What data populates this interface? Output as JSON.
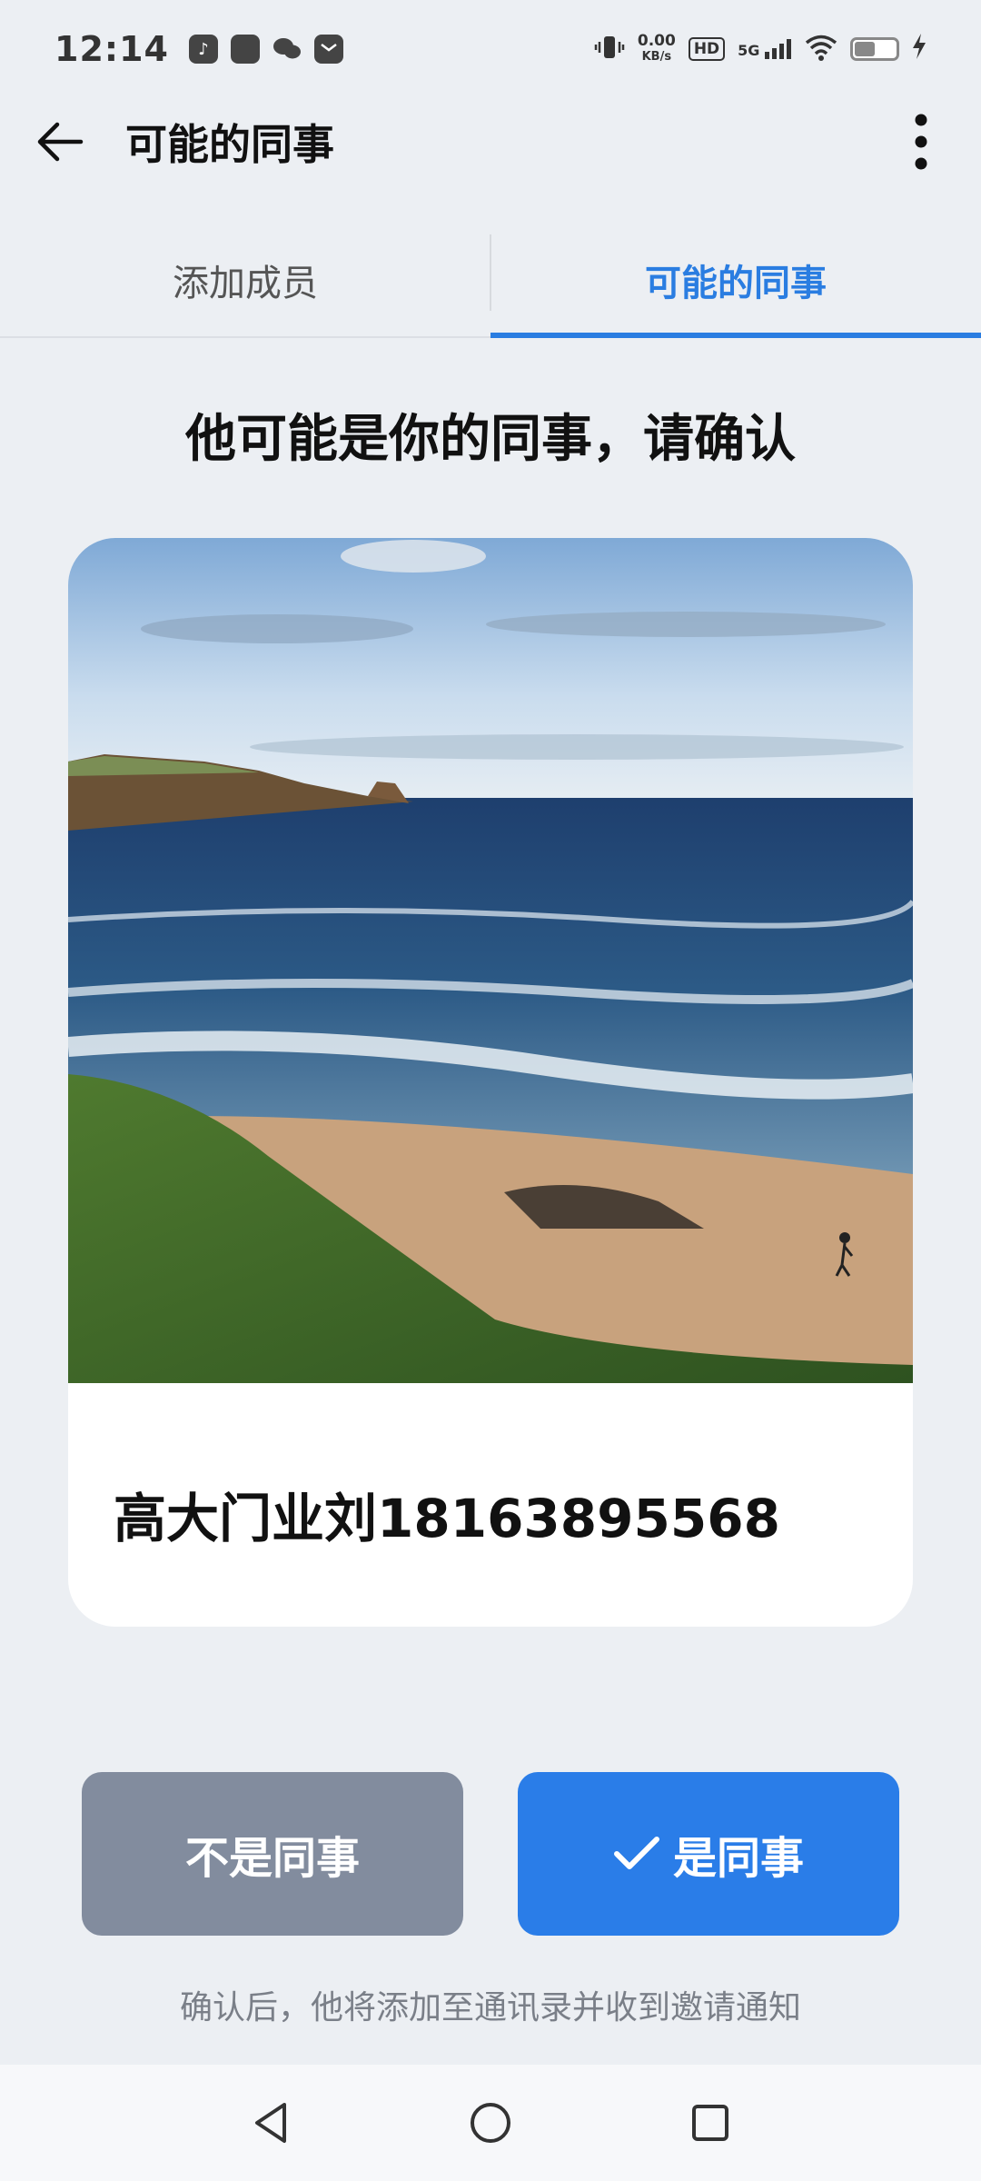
{
  "status_bar": {
    "time": "12:14",
    "net_speed_value": "0.00",
    "net_speed_unit": "KB/s",
    "hd_label": "HD",
    "network_label": "5G",
    "app_icons": [
      "tiktok-icon",
      "app-icon",
      "wechat-icon",
      "mail-icon"
    ]
  },
  "appbar": {
    "title": "可能的同事"
  },
  "tabs": [
    {
      "label": "添加成员",
      "active": false
    },
    {
      "label": "可能的同事",
      "active": true
    }
  ],
  "headline": "他可能是你的同事，请确认",
  "card": {
    "contact_name": "高大门业刘18163895568"
  },
  "actions": {
    "reject_label": "不是同事",
    "confirm_label": "是同事"
  },
  "footnote": "确认后，他将添加至通讯录并收到邀请通知",
  "colors": {
    "accent": "#2a7de8",
    "reject_button": "#828c9e",
    "background": "#eceff3"
  }
}
